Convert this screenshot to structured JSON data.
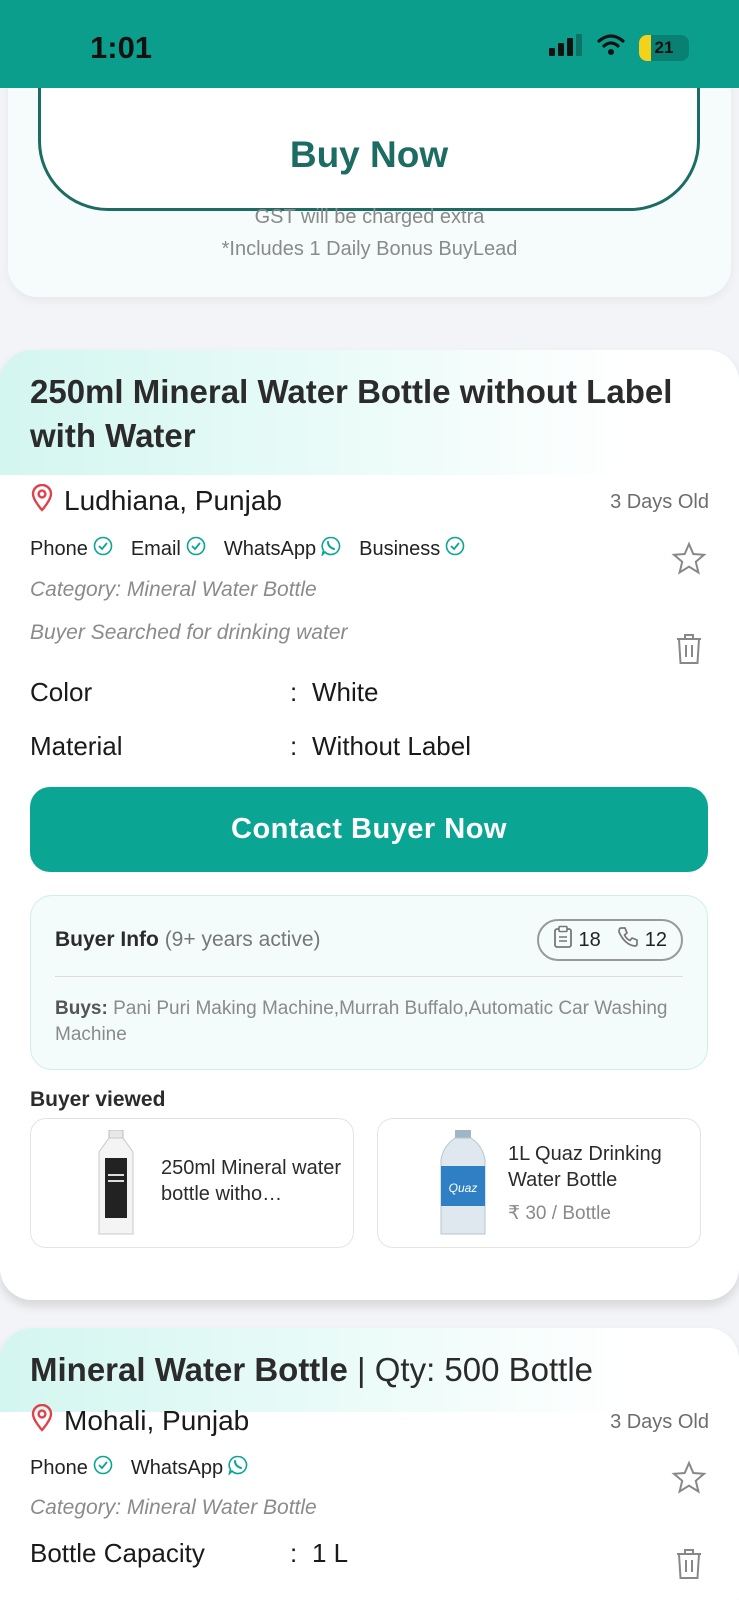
{
  "status_bar": {
    "time": "1:01",
    "battery": "21"
  },
  "top_card": {
    "buy_now_label": "Buy Now",
    "gst_note": "GST will be charged extra",
    "bonus_note": "*Includes 1 Daily Bonus BuyLead"
  },
  "lead1": {
    "title": "250ml Mineral Water Bottle without Label with Water",
    "location": "Ludhiana, Punjab",
    "age": "3 Days Old",
    "verifications": [
      "Phone",
      "Email",
      "WhatsApp",
      "Business"
    ],
    "category": "Category: Mineral Water Bottle",
    "searched": "Buyer Searched for drinking water",
    "specs": [
      {
        "key": "Color",
        "value": "White"
      },
      {
        "key": "Material",
        "value": "Without Label"
      }
    ],
    "contact_label": "Contact Buyer Now",
    "buyer_info": {
      "title": "Buyer Info",
      "years": "(9+ years active)",
      "requirements_count": "18",
      "calls_count": "12",
      "buys_label": "Buys:",
      "buys_value": "Pani Puri Making Machine,Murrah Buffalo,Automatic Car Washing Machine"
    },
    "viewed_label": "Buyer viewed",
    "viewed": [
      {
        "name": "250ml Mineral water bottle witho…",
        "price": ""
      },
      {
        "name": "1L Quaz Drinking Water Bottle",
        "price": "₹ 30 / Bottle"
      }
    ]
  },
  "lead2": {
    "title": "Mineral Water Bottle",
    "separator": "|",
    "qty": "Qty: 500 Bottle",
    "location": "Mohali, Punjab",
    "age": "3 Days Old",
    "verifications": [
      "Phone",
      "WhatsApp"
    ],
    "category": "Category: Mineral Water Bottle",
    "specs": [
      {
        "key": "Bottle Capacity",
        "value": "1 L"
      }
    ]
  },
  "colors": {
    "brand": "#0b9e8c",
    "button": "#0ba594",
    "dark_green": "#1d6c63"
  }
}
